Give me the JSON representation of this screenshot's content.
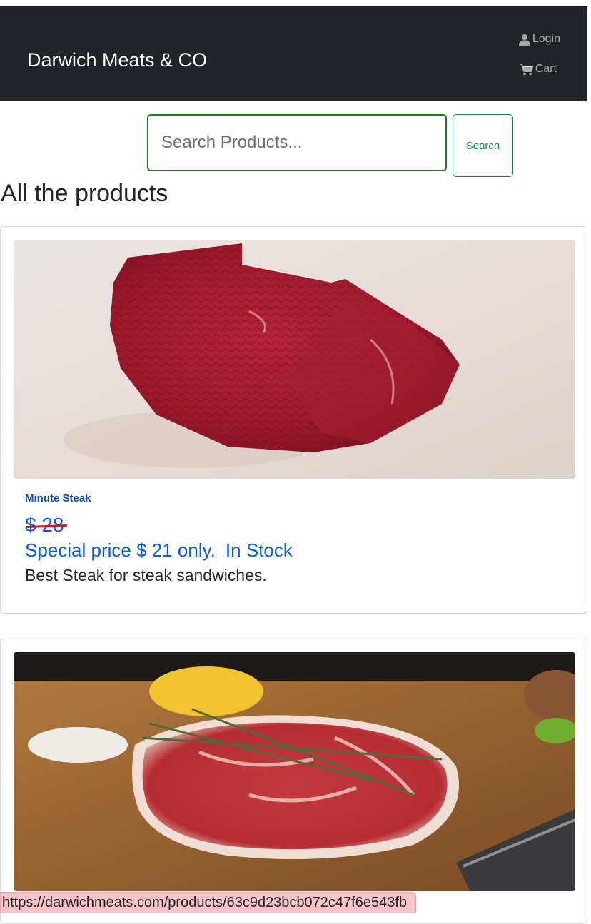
{
  "header": {
    "brand": "Darwich Meats & CO",
    "login_label": "Login",
    "cart_label": "Cart",
    "login_icon": "user-icon",
    "cart_icon": "shopping-cart-icon"
  },
  "search": {
    "placeholder": "Search Products...",
    "button_label": "Search"
  },
  "page": {
    "heading": "All the products"
  },
  "products": [
    {
      "name": "Minute Steak",
      "old_price": "$ 28",
      "special_price_text": "Special price $ 21 only.",
      "stock_status": "In Stock",
      "description": "Best Steak for steak sandwiches.",
      "image": "raw-minute-steak-photo"
    },
    {
      "image": "ribeye-steak-on-board-photo"
    }
  ],
  "status_bar": {
    "url": "https://darwichmeats.com/products/63c9d23bcb072c47f6e543fb"
  },
  "colors": {
    "navbar": "#212529",
    "accent_green": "#198754",
    "product_blue": "#0d5ad6",
    "strike_red": "#d01818"
  }
}
